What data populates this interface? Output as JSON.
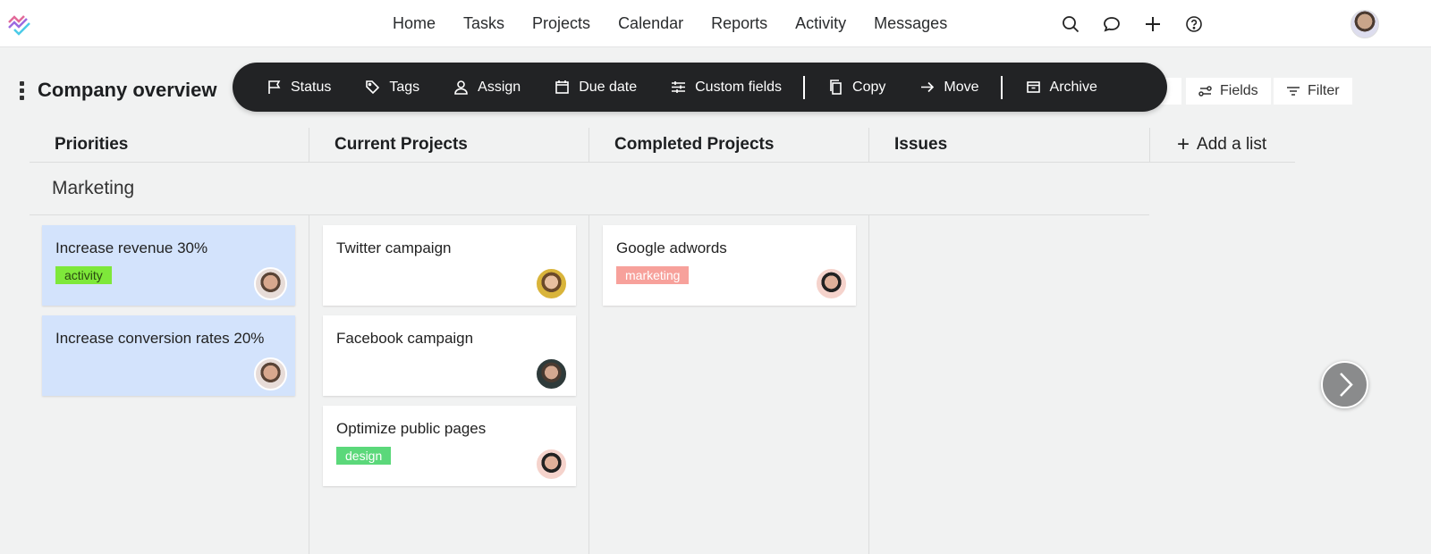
{
  "nav": [
    "Home",
    "Tasks",
    "Projects",
    "Calendar",
    "Reports",
    "Activity",
    "Messages"
  ],
  "page_title": "Company overview",
  "toolbar": {
    "status": "Status",
    "tags": "Tags",
    "assign": "Assign",
    "due_date": "Due date",
    "custom_fields": "Custom fields",
    "copy": "Copy",
    "move": "Move",
    "archive": "Archive"
  },
  "right_buttons": {
    "fields": "Fields",
    "filter": "Filter"
  },
  "columns": [
    "Priorities",
    "Current Projects",
    "Completed Projects",
    "Issues"
  ],
  "add_list": "Add a list",
  "lane": "Marketing",
  "cards": [
    {
      "title": "Increase revenue 30%",
      "tag": "activity",
      "tag_color": "#7ee83a",
      "bg": "#d3e3fc"
    },
    {
      "title": "Increase conversion rates 20%",
      "bg": "#d3e3fc"
    },
    {
      "title": "Twitter campaign"
    },
    {
      "title": "Facebook campaign"
    },
    {
      "title": "Optimize public pages",
      "tag": "design",
      "tag_color": "#5bd87a"
    },
    {
      "title": "Google adwords",
      "tag": "marketing",
      "tag_color": "#f7a19b"
    }
  ]
}
